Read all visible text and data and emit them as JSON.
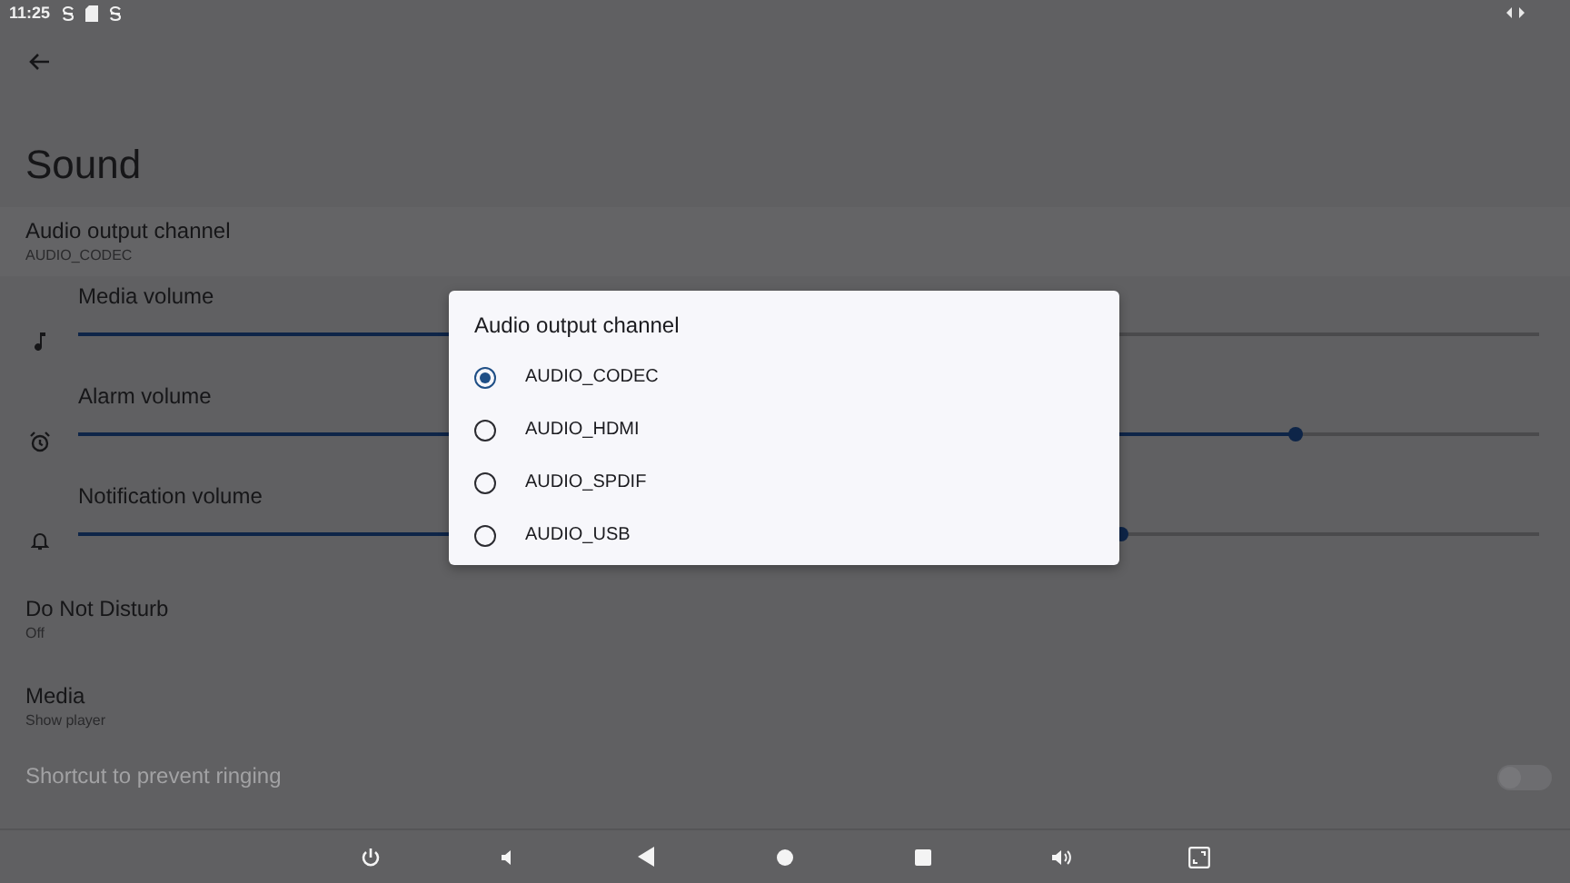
{
  "status_bar": {
    "time": "11:25"
  },
  "title": "Sound",
  "settings": [
    {
      "kind": "setting",
      "title": "Audio output channel",
      "summary": "AUDIO_CODEC",
      "disabled": false
    },
    {
      "kind": "slider",
      "title": "Media volume",
      "level": 0.3
    },
    {
      "kind": "slider",
      "title": "Alarm volume",
      "level": 0.833
    },
    {
      "kind": "slider",
      "title": "Notification volume",
      "level": 0.714
    },
    {
      "kind": "setting",
      "title": "Do Not Disturb",
      "summary": "Off",
      "disabled": false
    },
    {
      "kind": "setting",
      "title": "Media",
      "summary": "Show player",
      "disabled": false
    },
    {
      "kind": "switch",
      "title": "Shortcut to prevent ringing",
      "disabled": true,
      "on": false
    }
  ],
  "dialog": {
    "title": "Audio output channel",
    "options": [
      {
        "label": "AUDIO_CODEC",
        "selected": true
      },
      {
        "label": "AUDIO_HDMI",
        "selected": false
      },
      {
        "label": "AUDIO_SPDIF",
        "selected": false
      },
      {
        "label": "AUDIO_USB",
        "selected": false
      }
    ]
  }
}
